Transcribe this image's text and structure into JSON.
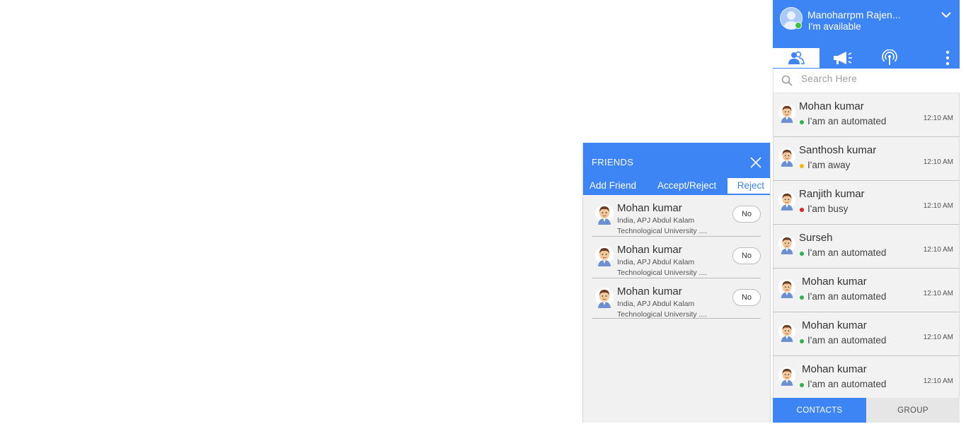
{
  "friends_panel": {
    "title": "FRIENDS",
    "tabs": [
      "Add Friend",
      "Accept/Reject",
      "Reject"
    ],
    "active_tab": "Reject",
    "requests": [
      {
        "name": "Mohan kumar",
        "line1": "India, APJ Abdul Kalam",
        "line2": "Technological University ....",
        "button": "No"
      },
      {
        "name": "Mohan kumar",
        "line1": "India, APJ Abdul Kalam",
        "line2": "Technological University ....",
        "button": "No"
      },
      {
        "name": "Mohan kumar",
        "line1": "India, APJ Abdul Kalam",
        "line2": "Technological University ....",
        "button": "No"
      }
    ]
  },
  "chat": {
    "user": {
      "name": "Manoharrpm Rajen...",
      "status": "I'm available"
    },
    "icons": [
      "contacts-icon",
      "megaphone-icon",
      "broadcast-icon",
      "more-vertical-icon"
    ],
    "search": {
      "placeholder": "Search Here"
    },
    "contacts": [
      {
        "name": "Mohan kumar",
        "status": "I'am an automated",
        "time": "12:10 AM",
        "presence": "#2fb34a"
      },
      {
        "name": "Santhosh kumar",
        "status": "I'am away",
        "time": "12:10 AM",
        "presence": "#f5b800"
      },
      {
        "name": "Ranjith kumar",
        "status": "I'am busy",
        "time": "12:10 AM",
        "presence": "#e02020"
      },
      {
        "name": "Surseh",
        "status": "I'am an automated",
        "time": "12:10 AM",
        "presence": "#2fb34a"
      },
      {
        "name": "Mohan kumar",
        "status": "I'am an automated",
        "time": "12:10 AM",
        "presence": "#2fb34a"
      },
      {
        "name": "Mohan kumar",
        "status": "I'am an automated",
        "time": "12:10 AM",
        "presence": "#2fb34a"
      },
      {
        "name": "Mohan kumar",
        "status": "I'am an automated",
        "time": "12:10 AM",
        "presence": "#2fb34a"
      }
    ],
    "bottom_tabs": [
      "CONTACTS",
      "GROUP"
    ],
    "active_bottom_tab": "CONTACTS"
  },
  "colors": {
    "accent": "#3d84f5",
    "available": "#2fb34a",
    "away": "#f5b800",
    "busy": "#e02020"
  }
}
